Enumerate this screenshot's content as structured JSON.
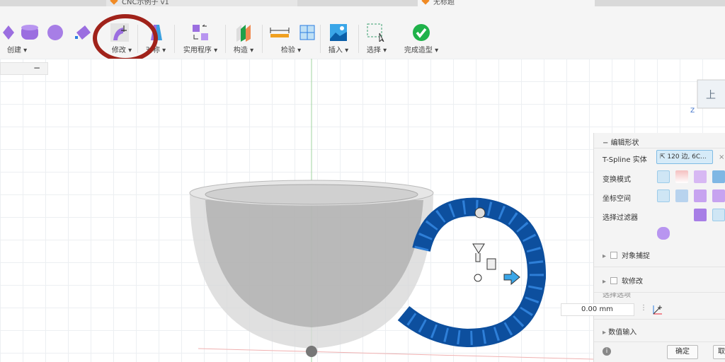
{
  "tabs": [
    {
      "label": "CNC示例子 v1"
    },
    {
      "label": "无标题"
    }
  ],
  "toolbar": {
    "create": "创建 ▾",
    "modify": "修改 ▾",
    "symmetry": "对称 ▾",
    "utilities": "实用程序 ▾",
    "construct": "构造 ▾",
    "inspect": "检验 ▾",
    "insert": "插入 ▾",
    "select": "选择 ▾",
    "finish": "完成造型 ▾"
  },
  "left_panel": {
    "collapse": "−"
  },
  "edit_form": {
    "title": "编辑形状",
    "tspline_label": "T-Spline 实体",
    "tspline_value": "120 边, 6C...",
    "clear": "×",
    "transform_mode": "变换模式",
    "coord_space": "坐标空间",
    "selection_filter": "选择过滤器",
    "object_snap": "对象捕捉",
    "soft_modify": "软修改",
    "selection_options": "选择选项",
    "numeric_input": "数值输入",
    "ok": "确定",
    "cancel": "取消",
    "value": "0.00 mm"
  },
  "colors": {
    "accent": "#1f77c9",
    "highlight": "#a0221a",
    "finish": "#1fb24a"
  }
}
